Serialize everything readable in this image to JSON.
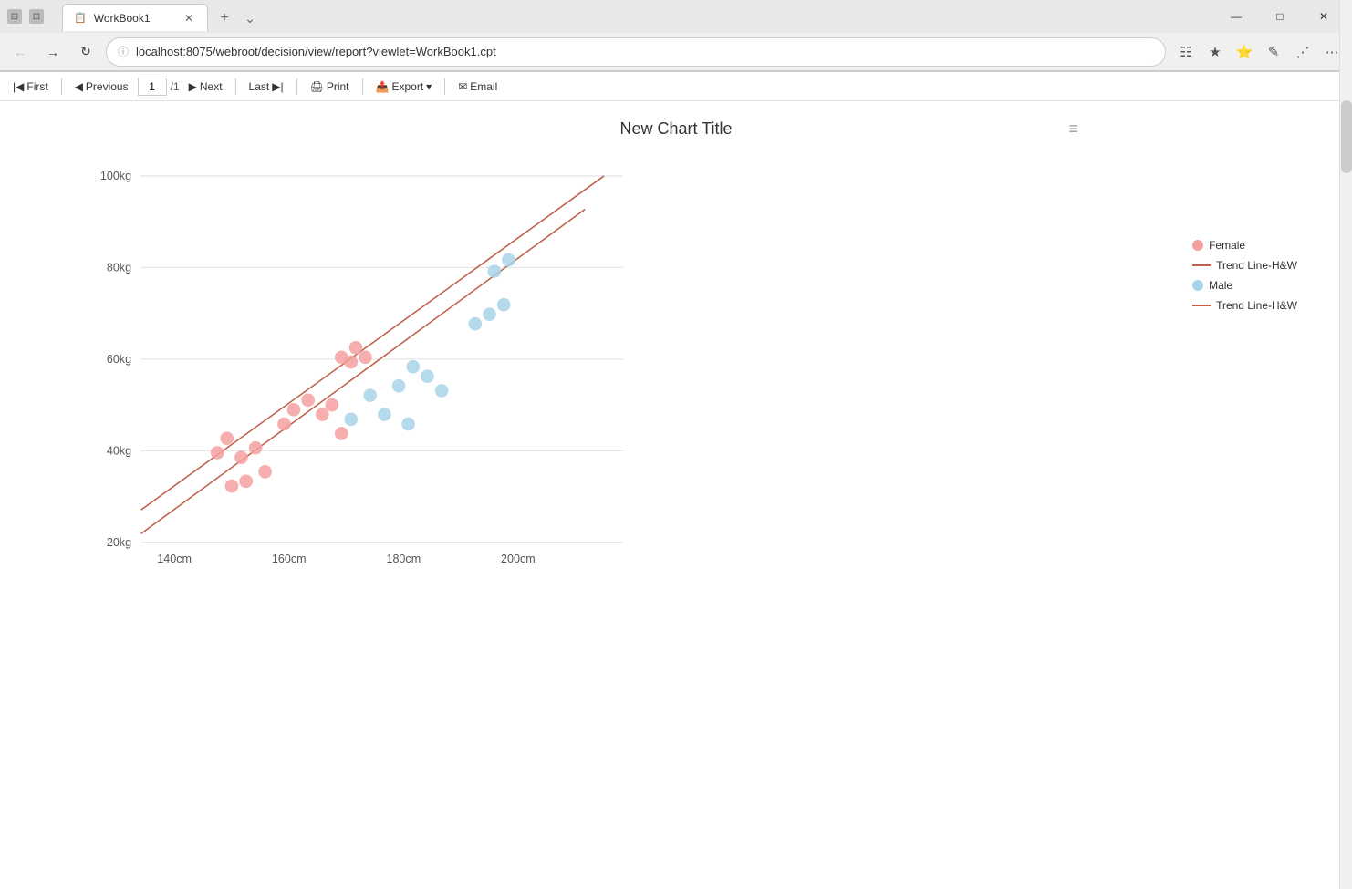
{
  "browser": {
    "tab_title": "WorkBook1",
    "tab_favicon": "📋",
    "url": "localhost:8075/webroot/decision/view/report?viewlet=WorkBook1.cpt",
    "new_tab_label": "+",
    "overflow_label": "⌄",
    "minimize_label": "—",
    "maximize_label": "□",
    "close_label": "✕"
  },
  "toolbar": {
    "first_label": "First",
    "previous_label": "Previous",
    "page_current": "1",
    "page_total": "/1",
    "next_label": "Next",
    "last_label": "Last",
    "print_label": "Print",
    "export_label": "Export",
    "export_arrow": "▾",
    "email_label": "Email"
  },
  "chart": {
    "title": "New Chart Title",
    "menu_icon": "≡",
    "x_labels": [
      "140cm",
      "160cm",
      "180cm",
      "200cm"
    ],
    "y_labels": [
      "100kg",
      "80kg",
      "60kg",
      "40kg",
      "20kg"
    ],
    "legend": [
      {
        "type": "dot",
        "color": "#f4a0a0",
        "label": "Female"
      },
      {
        "type": "line",
        "color": "#c0614a",
        "label": "Trend Line-H&W"
      },
      {
        "type": "dot",
        "color": "#a8d4e8",
        "label": "Male"
      },
      {
        "type": "line",
        "color": "#c0614a",
        "label": "Trend Line-H&W"
      }
    ]
  }
}
